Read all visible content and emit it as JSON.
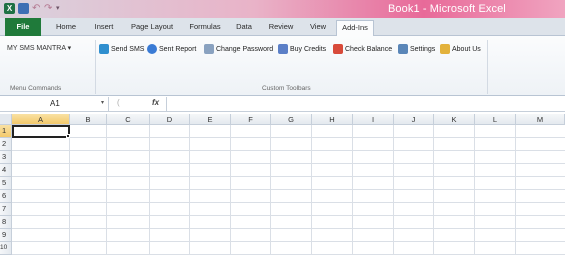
{
  "window": {
    "title": "Book1 - Microsoft Excel"
  },
  "qat": {
    "excel_icon": "X",
    "save_icon": "save-icon",
    "undo_glyph": "↶",
    "redo_glyph": "↷",
    "more_glyph": "▾"
  },
  "tabs": [
    {
      "label": "File"
    },
    {
      "label": "Home"
    },
    {
      "label": "Insert"
    },
    {
      "label": "Page Layout"
    },
    {
      "label": "Formulas"
    },
    {
      "label": "Data"
    },
    {
      "label": "Review"
    },
    {
      "label": "View"
    },
    {
      "label": "Add-Ins"
    }
  ],
  "ribbon": {
    "menu_commands": {
      "label": "MY SMS MANTRA",
      "arrow": "▾",
      "group_label": "Menu Commands"
    },
    "toolbar": {
      "group_label": "Custom Toolbars",
      "items": [
        {
          "label": "Send SMS",
          "icon": "send-sms-icon",
          "color": "#2f8fcf"
        },
        {
          "label": "Sent Report",
          "icon": "sent-report-icon",
          "color": "#3a7bd5"
        },
        {
          "label": "Change Password",
          "icon": "change-password-icon",
          "color": "#8aa2c0"
        },
        {
          "label": "Buy Credits",
          "icon": "buy-credits-icon",
          "color": "#5b7fc7"
        },
        {
          "label": "Check Balance",
          "icon": "check-balance-icon",
          "color": "#d84a3a"
        },
        {
          "label": "Settings",
          "icon": "settings-icon",
          "color": "#5a86b8"
        },
        {
          "label": "About Us",
          "icon": "about-us-icon",
          "color": "#e3b23c"
        }
      ]
    }
  },
  "formula_bar": {
    "name_box": "A1",
    "dropdown": "▾",
    "cancel_glyph": "(",
    "fx_label": "fx",
    "value": ""
  },
  "sheet": {
    "columns": [
      "A",
      "B",
      "C",
      "D",
      "E",
      "F",
      "G",
      "H",
      "I",
      "J",
      "K",
      "L",
      "M"
    ],
    "rows": [
      "1",
      "2",
      "3",
      "4",
      "5",
      "6",
      "7",
      "8",
      "9",
      "10"
    ],
    "active_cell": "A1",
    "selection_color": "#f3c96b"
  }
}
